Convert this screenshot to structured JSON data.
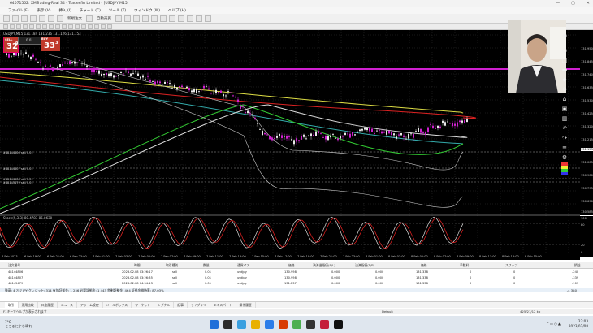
{
  "window": {
    "title": "64071562: XMTrading-Real 34 - Tradexfin Limited - [USDJPY,M15]",
    "controls": [
      "—",
      "▢",
      "✕"
    ]
  },
  "menu": [
    "ファイル (F)",
    "表示 (V)",
    "挿入 (I)",
    "チャート (C)",
    "ツール (T)",
    "ウィンドウ (W)",
    "ヘルプ (H)"
  ],
  "toolbar": {
    "new_order": "新規注文",
    "auto_trade": "自動売買"
  },
  "chart": {
    "label": "USDJPY,M15 131.184 131.236 131.126 131.153",
    "sell_label": "SELL",
    "buy_label": "BUY",
    "volume": "0.01",
    "sell_big": "32",
    "sell_sup": "9",
    "buy_big": "33",
    "buy_sup": "3",
    "price_levels": [
      "131.950",
      "131.845",
      "131.740",
      "131.635",
      "131.530",
      "131.425",
      "131.320",
      "131.215",
      "131.153",
      "131.005",
      "130.900",
      "130.795",
      "130.690",
      "130.585"
    ],
    "line_labels": [
      "#48144806 sell 0.01",
      "#48144807 sell 0.01",
      "#48144808 sell 0.01",
      "#48145479 sell 0.01"
    ],
    "osc_label": "Stoch(5,3,3) 80.4783 85.8630",
    "osc_levels": [
      "100",
      "80",
      "20",
      "0"
    ],
    "time_labels": [
      "6 Feb 2023",
      "6 Feb 19:00",
      "6 Feb 21:00",
      "6 Feb 23:00",
      "7 Feb 01:00",
      "7 Feb 03:00",
      "7 Feb 05:00",
      "7 Feb 07:00",
      "7 Feb 09:00",
      "7 Feb 11:00",
      "7 Feb 13:00",
      "7 Feb 15:00",
      "7 Feb 17:00",
      "7 Feb 19:00",
      "7 Feb 21:00",
      "7 Feb 23:00",
      "8 Feb 01:00",
      "8 Feb 03:00",
      "8 Feb 05:00",
      "8 Feb 07:00",
      "8 Feb 09:00",
      "8 Feb 11:00",
      "8 Feb 13:00",
      "8 Feb 15:00"
    ],
    "colors": {
      "magenta": "#d020d0",
      "red": "#d22",
      "green": "#3c3",
      "yellow": "#dd4",
      "teal": "#3aa",
      "white": "#ddd"
    }
  },
  "terminal": {
    "headers": [
      "注文番号",
      "時間",
      "取引種別",
      "数量",
      "通貨ペア",
      "価格",
      "決済逆指値(S/L)",
      "決済指値(T/P)",
      "価格",
      "手数料",
      "スワップ",
      "損益"
    ],
    "rows": [
      [
        "48144806",
        "2023.02.08 03:26:17",
        "sell",
        "0.01",
        "usdjpy",
        "130.998",
        "0.000",
        "0.000",
        "131.338",
        "0",
        "0",
        "-240"
      ],
      [
        "48144807",
        "2023.02.08 03:26:35",
        "sell",
        "0.01",
        "usdjpy",
        "130.998",
        "0.000",
        "0.000",
        "131.338",
        "0",
        "0",
        "-339"
      ],
      [
        "48145479",
        "2023.02.08 04:54:13",
        "sell",
        "0.01",
        "usdjpy",
        "131.237",
        "0.000",
        "0.000",
        "131.338",
        "0",
        "0",
        "-101"
      ]
    ],
    "summary": "残高: 4 757 JPY クレジット: 314  有効証拠金: 1 256  必要証拠金: 1 443  余剰証拠金: 464  証拠金維持率: 87.03%",
    "summary_total": "-4 380",
    "tabs": [
      "取引",
      "運用比較",
      "口座履歴",
      "ニュース",
      "アラーム設定",
      "メールボックス",
      "マーケット",
      "シグナル",
      "記事",
      "ライブラリ",
      "エキスパート",
      "操作履歴"
    ]
  },
  "status": {
    "help": "F1キーでヘルプが表示されます",
    "profile": "Default",
    "traffic": "425/27/12 kb"
  },
  "taskbar": {
    "temp": "7°C",
    "weather": "ところにより晴れ",
    "time": "23:03",
    "date": "2023/02/08",
    "app_colors": [
      "#1e6fd9",
      "#2b2b2b",
      "#3aa0e0",
      "#e8b000",
      "#2b7de9",
      "#d83b01",
      "#4caf50",
      "#333",
      "#c41e3a",
      "#111"
    ]
  }
}
